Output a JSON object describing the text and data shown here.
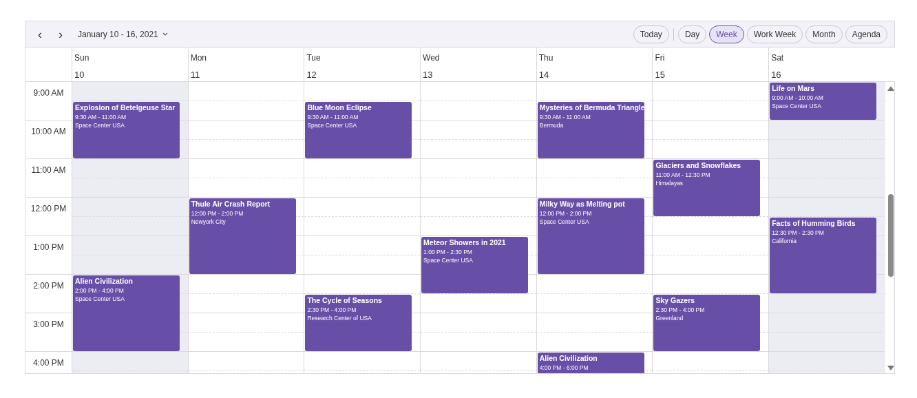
{
  "toolbar": {
    "prev": "‹",
    "next": "›",
    "date_range": "January 10 - 16, 2021",
    "today": "Today",
    "views": [
      {
        "label": "Day",
        "selected": false
      },
      {
        "label": "Week",
        "selected": true
      },
      {
        "label": "Work Week",
        "selected": false
      },
      {
        "label": "Month",
        "selected": false
      },
      {
        "label": "Agenda",
        "selected": false
      }
    ]
  },
  "time_slots": [
    "9:00 AM",
    "10:00 AM",
    "11:00 AM",
    "12:00 PM",
    "1:00 PM",
    "2:00 PM",
    "3:00 PM",
    "4:00 PM"
  ],
  "days": [
    {
      "name": "Sun",
      "date": "10",
      "working": false,
      "events": [
        {
          "title": "Explosion of Betelgeuse Star",
          "time": "9:30 AM - 11:00 AM",
          "location": "Space Center USA"
        },
        {
          "title": "Alien Civilization",
          "time": "2:00 PM - 4:00 PM",
          "location": "Space Center USA"
        }
      ]
    },
    {
      "name": "Mon",
      "date": "11",
      "working": true,
      "events": [
        {
          "title": "Thule Air Crash Report",
          "time": "12:00 PM - 2:00 PM",
          "location": "Newyork City"
        }
      ]
    },
    {
      "name": "Tue",
      "date": "12",
      "working": true,
      "events": [
        {
          "title": "Blue Moon Eclipse",
          "time": "9:30 AM - 11:00 AM",
          "location": "Space Center USA"
        },
        {
          "title": "The Cycle of Seasons",
          "time": "2:30 PM - 4:00 PM",
          "location": "Research Center of USA"
        }
      ]
    },
    {
      "name": "Wed",
      "date": "13",
      "working": true,
      "events": [
        {
          "title": "Meteor Showers in 2021",
          "time": "1:00 PM - 2:30 PM",
          "location": "Space Center USA"
        }
      ]
    },
    {
      "name": "Thu",
      "date": "14",
      "working": true,
      "events": [
        {
          "title": "Mysteries of Bermuda Triangle",
          "time": "9:30 AM - 11:00 AM",
          "location": "Bermuda"
        },
        {
          "title": "Milky Way as Melting pot",
          "time": "12:00 PM - 2:00 PM",
          "location": "Space Center USA"
        },
        {
          "title": "Alien Civilization",
          "time": "4:00 PM - 6:00 PM"
        }
      ]
    },
    {
      "name": "Fri",
      "date": "15",
      "working": true,
      "events": [
        {
          "title": "Glaciers and Snowflakes",
          "time": "11:00 AM - 12:30 PM",
          "location": "Himalayas"
        },
        {
          "title": "Sky Gazers",
          "time": "2:30 PM - 4:00 PM",
          "location": "Greenland"
        }
      ]
    },
    {
      "name": "Sat",
      "date": "16",
      "working": false,
      "events": [
        {
          "title": "Life on Mars",
          "time": "9:00 AM - 10:00 AM",
          "location": "Space Center USA"
        },
        {
          "title": "Facts of Humming Birds",
          "time": "12:30 PM - 2:30 PM",
          "location": "California"
        }
      ]
    }
  ]
}
